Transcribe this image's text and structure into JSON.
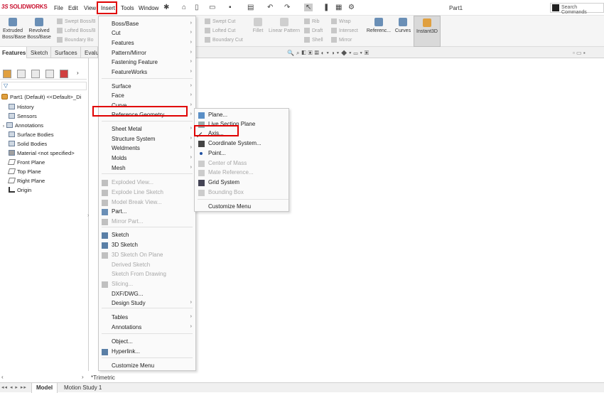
{
  "app": {
    "logo_ds": "3S",
    "logo_text": "SOLIDWORKS",
    "doc_title": "Part1",
    "search_placeholder": "Search Commands"
  },
  "menubar": [
    "File",
    "Edit",
    "View",
    "Insert",
    "Tools",
    "Window"
  ],
  "ribbon": {
    "extruded": "Extruded\nBoss/Base",
    "revolved": "Revolved\nBoss/Base",
    "swept_boss": "Swept Boss/B",
    "lofted_boss": "Lofted Boss/B",
    "boundary_boss": "Boundary Bo",
    "swept_cut": "Swept Cut",
    "lofted_cut": "Lofted Cut",
    "boundary_cut": "Boundary Cut",
    "fillet": "Fillet",
    "linear_pattern": "Linear Pattern",
    "rib": "Rib",
    "draft": "Draft",
    "shell": "Shell",
    "wrap": "Wrap",
    "intersect": "Intersect",
    "mirror": "Mirror",
    "reference": "Referenc...",
    "curves": "Curves",
    "instant3d": "Instant3D"
  },
  "cm_tabs": [
    "Features",
    "Sketch",
    "Surfaces",
    "Evalu"
  ],
  "tree": {
    "root": "Part1 (Default) <<Default>_Di",
    "items": [
      "History",
      "Sensors",
      "Annotations",
      "Surface Bodies",
      "Solid Bodies",
      "Material <not specified>",
      "Front Plane",
      "Top Plane",
      "Right Plane",
      "Origin"
    ]
  },
  "insert_menu": [
    {
      "label": "Boss/Base",
      "sub": true,
      "enabled": true
    },
    {
      "label": "Cut",
      "sub": true,
      "enabled": true
    },
    {
      "label": "Features",
      "sub": true,
      "enabled": true
    },
    {
      "label": "Pattern/Mirror",
      "sub": true,
      "enabled": true
    },
    {
      "label": "Fastening Feature",
      "sub": true,
      "enabled": true
    },
    {
      "label": "FeatureWorks",
      "sub": true,
      "enabled": true
    },
    {
      "label": "Surface",
      "sub": true,
      "enabled": true
    },
    {
      "label": "Face",
      "sub": true,
      "enabled": true
    },
    {
      "label": "Curve",
      "sub": true,
      "enabled": true
    },
    {
      "label": "Reference Geometry",
      "sub": true,
      "enabled": true
    },
    {
      "label": "Sheet Metal",
      "sub": true,
      "enabled": true
    },
    {
      "label": "Structure System",
      "sub": true,
      "enabled": true
    },
    {
      "label": "Weldments",
      "sub": true,
      "enabled": true
    },
    {
      "label": "Molds",
      "sub": true,
      "enabled": true
    },
    {
      "label": "Mesh",
      "sub": true,
      "enabled": true
    },
    {
      "label": "Exploded View...",
      "sub": false,
      "enabled": false
    },
    {
      "label": "Explode Line Sketch",
      "sub": false,
      "enabled": false
    },
    {
      "label": "Model Break View...",
      "sub": false,
      "enabled": false
    },
    {
      "label": "Part...",
      "sub": false,
      "enabled": true
    },
    {
      "label": "Mirror Part...",
      "sub": false,
      "enabled": false
    },
    {
      "label": "Sketch",
      "sub": false,
      "enabled": true
    },
    {
      "label": "3D Sketch",
      "sub": false,
      "enabled": true
    },
    {
      "label": "3D Sketch On Plane",
      "sub": false,
      "enabled": false
    },
    {
      "label": "Derived Sketch",
      "sub": false,
      "enabled": false
    },
    {
      "label": "Sketch From Drawing",
      "sub": false,
      "enabled": false
    },
    {
      "label": "Slicing...",
      "sub": false,
      "enabled": false
    },
    {
      "label": "DXF/DWG...",
      "sub": false,
      "enabled": true
    },
    {
      "label": "Design Study",
      "sub": true,
      "enabled": true
    },
    {
      "label": "Tables",
      "sub": true,
      "enabled": true
    },
    {
      "label": "Annotations",
      "sub": true,
      "enabled": true
    },
    {
      "label": "Object...",
      "sub": false,
      "enabled": true
    },
    {
      "label": "Hyperlink...",
      "sub": false,
      "enabled": true
    },
    {
      "label": "Customize Menu",
      "sub": false,
      "enabled": true
    }
  ],
  "ref_geom_menu": [
    {
      "label": "Plane...",
      "enabled": true
    },
    {
      "label": "Live Section Plane",
      "enabled": true
    },
    {
      "label": "Axis...",
      "enabled": true
    },
    {
      "label": "Coordinate System...",
      "enabled": true
    },
    {
      "label": "Point...",
      "enabled": true
    },
    {
      "label": "Center of Mass",
      "enabled": false
    },
    {
      "label": "Mate Reference...",
      "enabled": false
    },
    {
      "label": "Grid System",
      "enabled": true
    },
    {
      "label": "Bounding Box",
      "enabled": false
    },
    {
      "label": "Customize Menu",
      "enabled": true
    }
  ],
  "bottom": {
    "view_label": "*Trimetric",
    "tabs": [
      "Model",
      "Motion Study 1"
    ]
  },
  "colors": {
    "accent_red": "#e00000",
    "brand_red": "#c8102e",
    "disabled_text": "#a8a8a8"
  }
}
